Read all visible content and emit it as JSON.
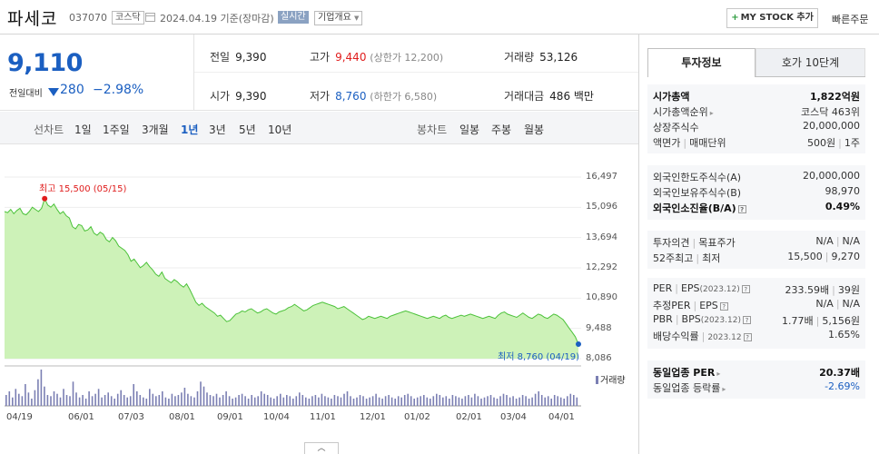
{
  "header": {
    "name": "파세코",
    "code": "037070",
    "market": "코스닥",
    "date": "2024.04.19 기준(장마감)",
    "realtime": "실시간",
    "company_info": "기업개요",
    "mystock": "MY STOCK 추가",
    "quick_order": "빠른주문"
  },
  "summary": {
    "price": "9,110",
    "change_label": "전일대비",
    "change": "280",
    "change_pct": "−2.98%",
    "prev_label": "전일",
    "prev": "9,390",
    "high_label": "고가",
    "high": "9,440",
    "upper_limit": "(상한가 12,200)",
    "volume_label": "거래량",
    "volume": "53,126",
    "open_label": "시가",
    "open": "9,390",
    "low_label": "저가",
    "low": "8,760",
    "lower_limit": "(하한가 6,580)",
    "amount_label": "거래대금",
    "amount": "486 백만"
  },
  "period": {
    "line_label": "선차트",
    "line_opts": [
      "1일",
      "1주일",
      "3개월",
      "1년",
      "3년",
      "5년",
      "10년"
    ],
    "selected": "1년",
    "candle_label": "봉차트",
    "candle_opts": [
      "일봉",
      "주봉",
      "월봉"
    ]
  },
  "chart_data": {
    "type": "area",
    "y_ticks": [
      "16,497",
      "15,096",
      "13,694",
      "12,292",
      "10,890",
      "9,488",
      "8,086"
    ],
    "ylim": [
      8086,
      16497
    ],
    "x_ticks": [
      "04/19",
      "06/01",
      "07/03",
      "08/01",
      "09/01",
      "10/04",
      "11/01",
      "12/01",
      "01/02",
      "02/01",
      "03/04",
      "04/01"
    ],
    "high_label": "최고 15,500 (05/15)",
    "low_label": "최저 8,760 (04/19)",
    "volume_label": "거래량",
    "colors": {
      "line": "#4cc23a",
      "fill": "#cdf2b8",
      "high": "#e01d1d",
      "low": "#1b5fc1",
      "volume": "#7b7fb3"
    },
    "prices": [
      14900,
      14850,
      15000,
      14800,
      14950,
      15050,
      14800,
      14750,
      14900,
      15100,
      15000,
      14900,
      15050,
      15500,
      15200,
      15100,
      15250,
      15000,
      14800,
      14900,
      14700,
      14600,
      14200,
      14100,
      14300,
      14250,
      14000,
      14050,
      14200,
      13900,
      13800,
      13950,
      13850,
      13600,
      13500,
      13700,
      13550,
      13300,
      13200,
      13100,
      12900,
      12600,
      12700,
      12500,
      12300,
      12400,
      12550,
      12350,
      12200,
      12000,
      11900,
      12100,
      11800,
      11700,
      11600,
      11750,
      11650,
      11500,
      11400,
      11550,
      11300,
      11000,
      10700,
      10550,
      10650,
      10500,
      10400,
      10300,
      10200,
      10050,
      10100,
      9950,
      9800,
      9850,
      10000,
      10150,
      10200,
      10300,
      10250,
      10350,
      10400,
      10300,
      10200,
      10250,
      10350,
      10400,
      10300,
      10200,
      10150,
      10250,
      10300,
      10350,
      10450,
      10500,
      10600,
      10500,
      10400,
      10300,
      10350,
      10450,
      10550,
      10600,
      10650,
      10700,
      10650,
      10600,
      10550,
      10500,
      10400,
      10450,
      10500,
      10400,
      10300,
      10200,
      10100,
      10000,
      9900,
      9950,
      10050,
      10000,
      9950,
      10000,
      10050,
      10000,
      9950,
      10050,
      10100,
      10150,
      10200,
      10250,
      10300,
      10250,
      10200,
      10150,
      10100,
      10050,
      10000,
      9950,
      10000,
      10050,
      10000,
      9950,
      10050,
      10100,
      10000,
      9950,
      10000,
      10050,
      10100,
      10050,
      10100,
      10150,
      10100,
      10050,
      10000,
      9950,
      10000,
      10050,
      10000,
      9950,
      10100,
      10200,
      10250,
      10150,
      10100,
      10050,
      10000,
      10100,
      10200,
      10100,
      10000,
      9950,
      10050,
      10150,
      10100,
      10000,
      9950,
      10050,
      10150,
      10100,
      10000,
      9900,
      9700,
      9500,
      9300,
      9100,
      8760
    ],
    "volumes": [
      9,
      12,
      7,
      14,
      10,
      8,
      18,
      11,
      6,
      13,
      22,
      30,
      16,
      9,
      8,
      12,
      10,
      7,
      14,
      9,
      8,
      20,
      11,
      7,
      9,
      6,
      12,
      8,
      10,
      14,
      7,
      9,
      11,
      8,
      6,
      10,
      13,
      9,
      7,
      8,
      18,
      12,
      9,
      7,
      6,
      14,
      10,
      8,
      9,
      12,
      7,
      6,
      10,
      8,
      9,
      11,
      15,
      10,
      8,
      7,
      12,
      20,
      16,
      11,
      9,
      8,
      10,
      7,
      9,
      12,
      8,
      6,
      7,
      9,
      10,
      8,
      6,
      9,
      7,
      8,
      12,
      10,
      9,
      7,
      6,
      8,
      10,
      7,
      9,
      8,
      6,
      8,
      11,
      9,
      7,
      6,
      8,
      9,
      7,
      10,
      8,
      7,
      6,
      9,
      8,
      7,
      10,
      12,
      8,
      6,
      7,
      9,
      8,
      6,
      7,
      8,
      10,
      7,
      6,
      8,
      9,
      7,
      6,
      8,
      7,
      9,
      10,
      8,
      6,
      7,
      8,
      9,
      7,
      6,
      8,
      10,
      9,
      7,
      8,
      6,
      9,
      8,
      7,
      6,
      8,
      9,
      7,
      10,
      8,
      6,
      7,
      8,
      9,
      7,
      6,
      8,
      10,
      9,
      7,
      8,
      6,
      7,
      9,
      8,
      6,
      7,
      10,
      12,
      9,
      7,
      8,
      6,
      9,
      8,
      7,
      6,
      8,
      10,
      9,
      7
    ]
  },
  "toggle_label": "︿",
  "right_panel": {
    "tabs": [
      "투자정보",
      "호가 10단계"
    ],
    "s1": [
      {
        "k": "시가총액",
        "v": "1,822억원"
      },
      {
        "k": "시가총액순위",
        "v": "코스닥 463위"
      },
      {
        "k": "상장주식수",
        "v": "20,000,000"
      },
      {
        "k": "액면가",
        "k2": "매매단위",
        "v": "500원",
        "v2": "1주"
      }
    ],
    "s2": [
      {
        "k": "외국인한도주식수(A)",
        "v": "20,000,000"
      },
      {
        "k": "외국인보유주식수(B)",
        "v": "98,970"
      },
      {
        "k": "외국인소진율(B/A)",
        "v": "0.49%"
      }
    ],
    "s3": [
      {
        "k": "투자의견",
        "k2": "목표주가",
        "v": "N/A",
        "v2": "N/A"
      },
      {
        "k": "52주최고",
        "k2": "최저",
        "v": "15,500",
        "v2": "9,270"
      }
    ],
    "s4": [
      {
        "k": "PER",
        "k2": "EPS",
        "k2note": "(2023.12)",
        "v": "233.59배",
        "v2": "39원"
      },
      {
        "k": "추정PER",
        "k2": "EPS",
        "v": "N/A",
        "v2": "N/A"
      },
      {
        "k": "PBR",
        "k2": "BPS",
        "k2note": "(2023.12)",
        "v": "1.77배",
        "v2": "5,156원"
      },
      {
        "k": "배당수익률",
        "knote": "2023.12",
        "v": "1.65%"
      }
    ],
    "s5": [
      {
        "k": "동일업종 PER",
        "v": "20.37배"
      },
      {
        "k": "동일업종 등락률",
        "v": "-2.69%"
      }
    ],
    "help": "?"
  }
}
